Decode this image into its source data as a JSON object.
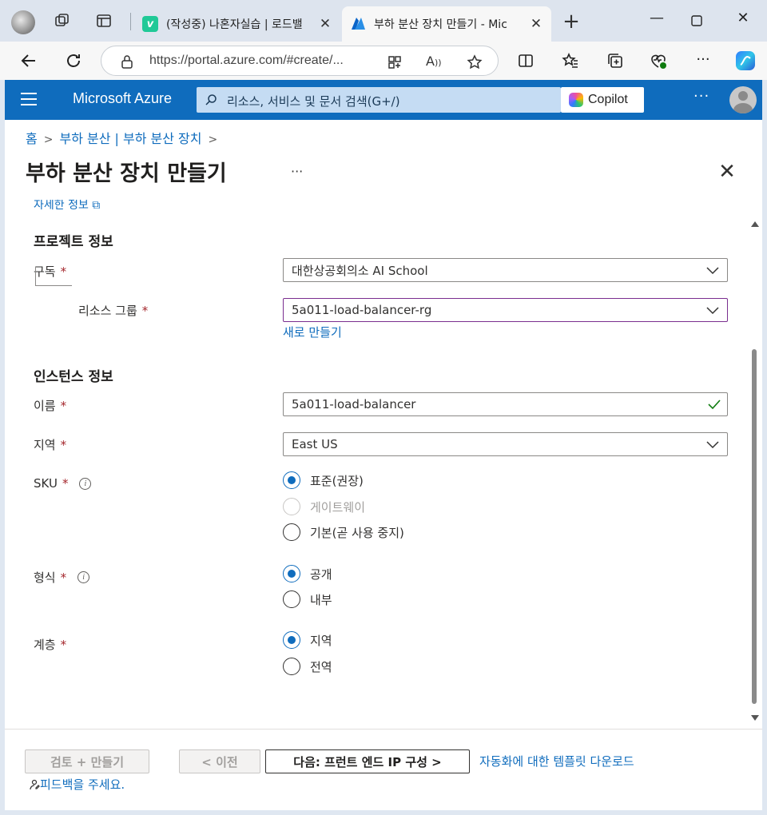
{
  "browser": {
    "tabs": [
      {
        "title": "(작성중) 나혼자실습 | 로드밸",
        "favicon": "v-icon",
        "active": false
      },
      {
        "title": "부하 분산 장치 만들기 - Mic",
        "favicon": "azure-icon",
        "active": true
      }
    ],
    "url": "https://portal.azure.com/#create/..."
  },
  "azure": {
    "brand": "Microsoft Azure",
    "search_placeholder": "리소스, 서비스 및 문서 검색(G+/)",
    "copilot_label": "Copilot",
    "more": "···"
  },
  "breadcrumb": [
    {
      "label": "홈"
    },
    {
      "label": "부하 분산 | 부하 분산 장치"
    }
  ],
  "page": {
    "title": "부하 분산 장치 만들기",
    "more": "···",
    "cut_link": "자세한 정보 ⧉"
  },
  "project": {
    "heading": "프로젝트 정보",
    "subscription_label": "구독",
    "subscription_value": "대한상공회의소 AI School",
    "resource_group_label": "리소스 그룹",
    "resource_group_value": "5a011-load-balancer-rg",
    "create_new": "새로 만들기"
  },
  "instance": {
    "heading": "인스턴스 정보",
    "name_label": "이름",
    "name_value": "5a011-load-balancer",
    "region_label": "지역",
    "region_value": "East US",
    "sku_label": "SKU",
    "sku_options": [
      {
        "label": "표준(권장)",
        "selected": true,
        "disabled": false
      },
      {
        "label": "게이트웨이",
        "selected": false,
        "disabled": true
      },
      {
        "label": "기본(곧 사용 중지)",
        "selected": false,
        "disabled": false
      }
    ],
    "type_label": "형식",
    "type_options": [
      {
        "label": "공개",
        "selected": true
      },
      {
        "label": "내부",
        "selected": false
      }
    ],
    "tier_label": "계층",
    "tier_options": [
      {
        "label": "지역",
        "selected": true
      },
      {
        "label": "전역",
        "selected": false
      }
    ],
    "required_mark": "*"
  },
  "footer": {
    "review_create": "검토 + 만들기",
    "previous": "< 이전",
    "next": "다음: 프런트 엔드 IP 구성 >",
    "template_link": "자동화에 대한 템플릿 다운로드",
    "feedback": "피드백을 주세요."
  },
  "colors": {
    "azure_blue": "#0f6cbd",
    "required": "#a4262c",
    "valid_check": "#107c10"
  }
}
